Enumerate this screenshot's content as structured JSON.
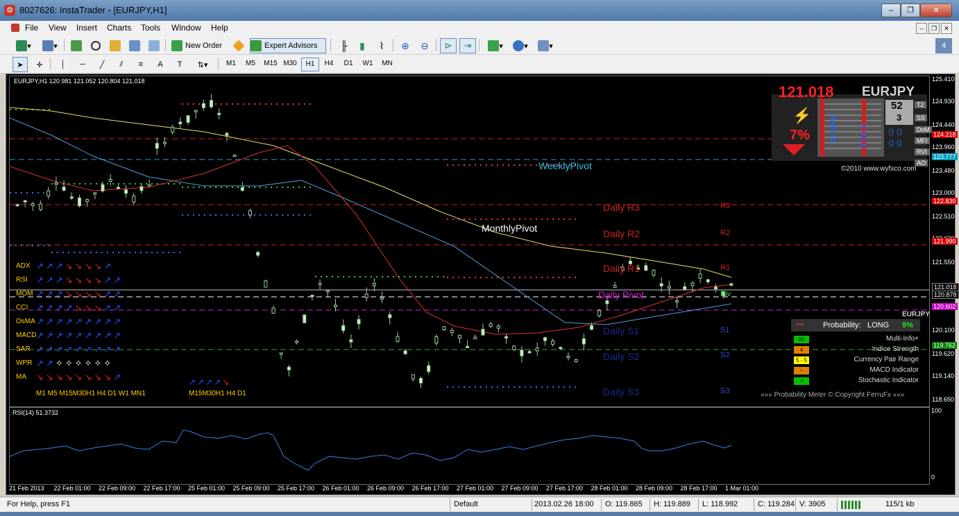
{
  "window": {
    "title": "8027626: InstaTrader - [EURJPY,H1]",
    "buttons": [
      "–",
      "❐",
      "✕"
    ]
  },
  "menu": {
    "items": [
      "File",
      "View",
      "Insert",
      "Charts",
      "Tools",
      "Window",
      "Help"
    ]
  },
  "toolbar": {
    "new_order": "New Order",
    "expert_advisors": "Expert Advisors",
    "timeframes": [
      "M1",
      "M5",
      "M15",
      "M30",
      "H1",
      "H4",
      "D1",
      "W1",
      "MN"
    ],
    "active_timeframe": "H1"
  },
  "chart": {
    "header": "EURJPY,H1  120.981 121.052 120.804 121.018",
    "price_big": "121.018",
    "symbol_big": "EURJPY",
    "meter_pct": "7%",
    "meter_num_top": "52",
    "meter_num_bottom": "3",
    "copyright": "©2010 www.wyfxco.com",
    "vertical_labels": [
      "GLOBAL",
      "TITAN II"
    ],
    "badge_labels": [
      "T2",
      "SS",
      "DoM",
      "MFI",
      "RVI",
      "AO"
    ],
    "pivot_labels": {
      "weekly": "WeeklyPivot",
      "monthly": "MonthlyPivot",
      "r3": "Daily R3",
      "r2": "Daily R2",
      "r1": "Daily R1",
      "pivot": "Daily Pivot",
      "s1": "Daily S1",
      "s2": "Daily S2",
      "s3": "Daily S3",
      "r3s": "R3",
      "r2s": "R2",
      "r1s": "R1",
      "pivs": "Piv",
      "s1s": "S1",
      "s2s": "S2",
      "s3s": "S3"
    },
    "indicators": [
      "ADX",
      "RSI",
      "MOM",
      "CCI",
      "OsMA",
      "MACD",
      "SAR",
      "WPR",
      "MA"
    ],
    "tf_row_left": "M1  M5  M15M30H1  H4  D1  W1 MN1",
    "tf_row_right": "M15M30H1  H4  D1",
    "probability": {
      "symbol": "EURJPY",
      "label": "Probability:",
      "direction": "LONG",
      "value": "9%",
      "rows": [
        {
          "badge": "66",
          "label": "Multi-Info+",
          "color": "#00c000"
        },
        {
          "badge": "4",
          "label": "Indice Strength",
          "color": "#e08000"
        },
        {
          "badge": "5 - 5",
          "label": "Currency Pair Range",
          "color": "#ffff00"
        },
        {
          "badge": "~",
          "label": "MACD Indicator",
          "color": "#e08000"
        },
        {
          "badge": "↗",
          "label": "Stochastic Indicator",
          "color": "#00c000"
        }
      ],
      "footer": "»»»  Probability Meter © Copyright FerruFx  «««"
    },
    "price_axis": [
      "125.410",
      "124.930",
      "124.440",
      "124.218",
      "123.960",
      "123.777",
      "123.480",
      "123.000",
      "122.830",
      "122.510",
      "122.030",
      "121.990",
      "121.550",
      "121.018",
      "120.878",
      "120.602",
      "120.100",
      "119.762",
      "119.620",
      "119.140",
      "118.650"
    ],
    "price_tags": {
      "124.218": "#d00000",
      "123.777": "#00a0c0",
      "122.830": "#d00000",
      "121.990": "#d00000",
      "121.018": "#000000",
      "120.878": "#000000",
      "120.602": "#c000c0",
      "119.762": "#008000"
    },
    "rsi_header": "RSI(14) 51.3732",
    "rsi_axis": [
      "100",
      "0"
    ],
    "time_axis": [
      "21 Feb 2013",
      "22 Feb 01:00",
      "22 Feb 09:00",
      "22 Feb 17:00",
      "25 Feb 01:00",
      "25 Feb 09:00",
      "25 Feb 17:00",
      "26 Feb 01:00",
      "26 Feb 09:00",
      "26 Feb 17:00",
      "27 Feb 01:00",
      "27 Feb 09:00",
      "27 Feb 17:00",
      "28 Feb 01:00",
      "28 Feb 09:00",
      "28 Feb 17:00",
      "1 Mar 01:00"
    ]
  },
  "status": {
    "help": "For Help, press F1",
    "profile": "Default",
    "datetime": "2013.02.26 18:00",
    "open": "O: 119.865",
    "high": "H: 119.889",
    "low": "L: 118.992",
    "close": "C: 119.284",
    "volume": "V: 3905",
    "traffic": "115/1 kb"
  }
}
